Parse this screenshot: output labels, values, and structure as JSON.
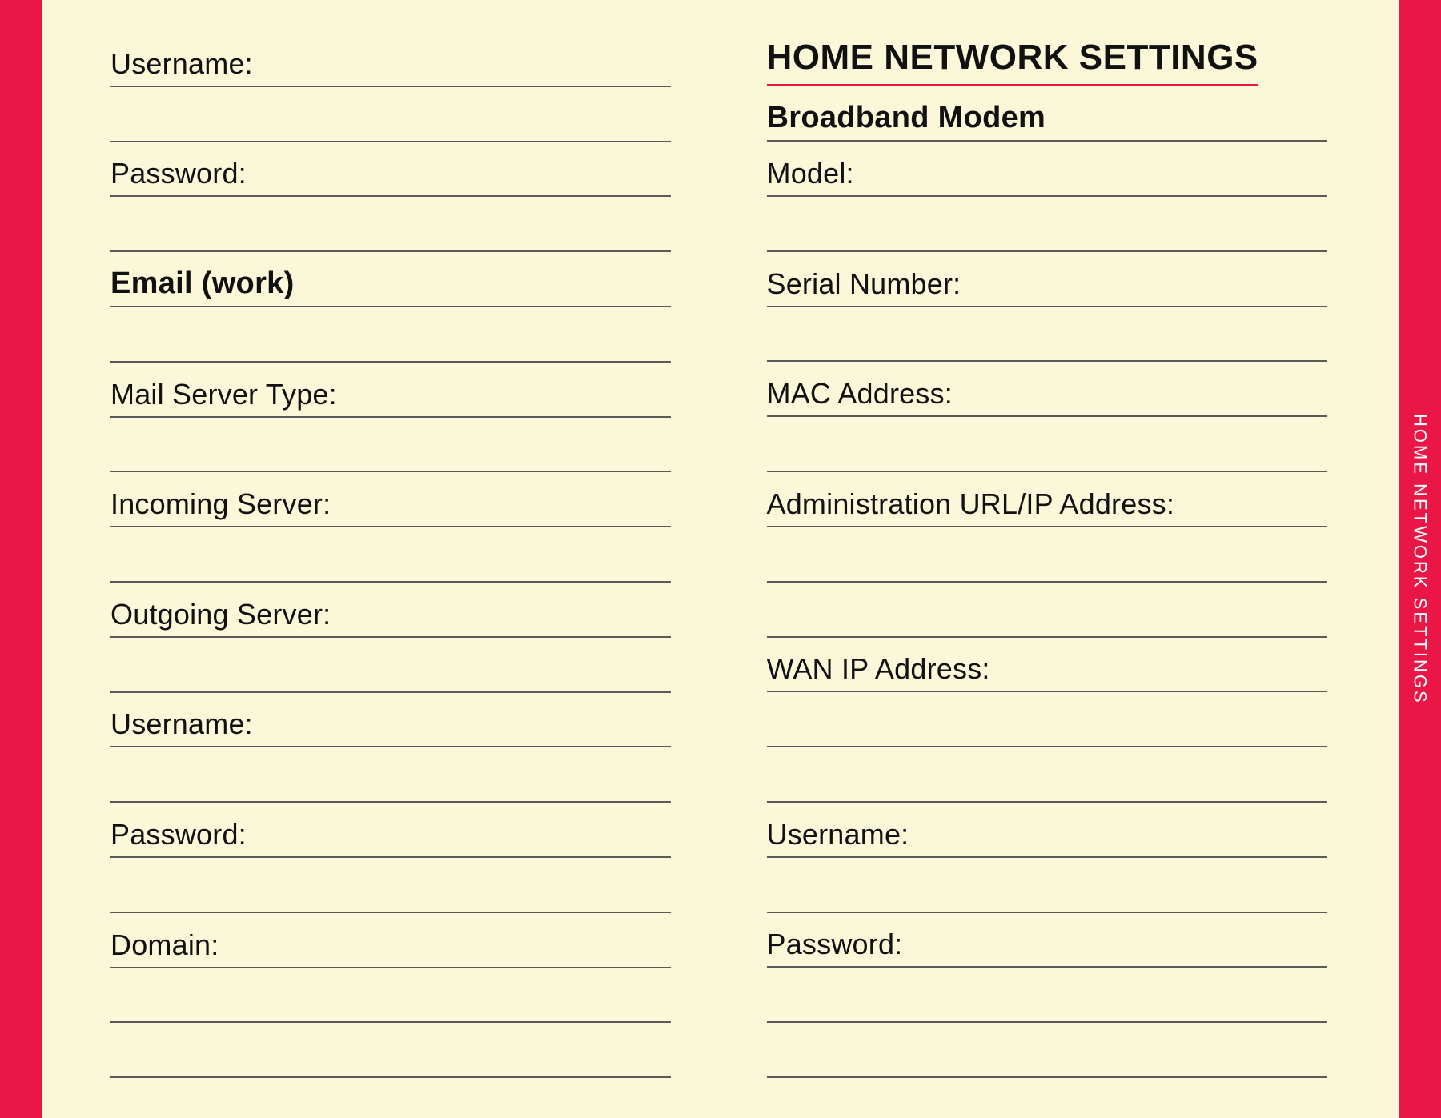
{
  "left_column": {
    "fields": [
      "Username:",
      "",
      "Password:",
      ""
    ],
    "section_title": "Email (work)",
    "section_fields": [
      "",
      "Mail Server Type:",
      "",
      "Incoming Server:",
      "",
      "Outgoing Server:",
      "",
      "Username:",
      "",
      "Password:",
      "",
      "Domain:",
      "",
      ""
    ]
  },
  "right_column": {
    "heading": "HOME NETWORK SETTINGS",
    "section_title": "Broadband Modem",
    "fields": [
      "Model:",
      "",
      "Serial Number:",
      "",
      "MAC Address:",
      "",
      "Administration URL/IP Address:",
      "",
      "",
      "WAN IP Address:",
      "",
      "",
      "Username:",
      "",
      "Password:",
      "",
      ""
    ]
  },
  "tab_label": "HOME NETWORK SETTINGS"
}
